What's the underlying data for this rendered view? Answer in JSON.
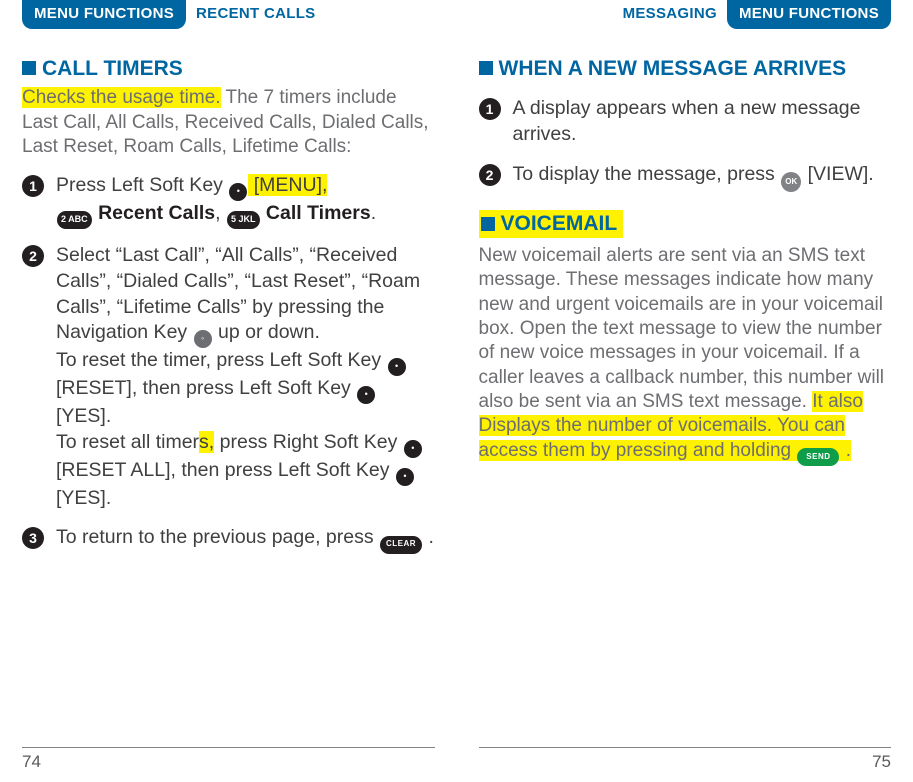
{
  "left": {
    "menuTab": "MENU FUNCTIONS",
    "sectionLabel": "RECENT CALLS",
    "heading": "CALL TIMERS",
    "intro_hl": "Checks the usage time.",
    "intro_rest": " The 7 timers include Last Call, All Calls, Received Calls, Dialed Calls, Last Reset, Roam Calls, Lifetime Calls:",
    "step1_a": "Press Left Soft Key ",
    "step1_b_hl": " [MENU], ",
    "step1_c_bold": " Recent Calls",
    "step1_d": ", ",
    "step1_e_bold": " Call Timers",
    "step1_f": ".",
    "step2_a": "Select “Last Call”, “All Calls”, “Received Calls”, “Dialed Calls”, “Last Reset”, “Roam Calls”, “Lifetime Calls” by pressing the Navigation Key ",
    "step2_b": " up or down.",
    "step2_c": "To reset the timer, press Left Soft Key ",
    "step2_d": " [RESET], then press Left Soft Key ",
    "step2_e": " [YES].",
    "step2_f": "To reset all timer",
    "step2_g_hl": "s,",
    "step2_h": " press Right Soft Key ",
    "step2_i": " [RESET ALL], then press Left Soft Key ",
    "step2_j": " [YES].",
    "step3_a": "To return to the previous page, press ",
    "step3_b": " .",
    "key2": "2 ABC",
    "key5": "5 JKL",
    "keyClear": "CLEAR",
    "pageNum": "74"
  },
  "right": {
    "menuTab": "MENU FUNCTIONS",
    "sectionLabel": "MESSAGING",
    "heading": "WHEN A NEW MESSAGE ARRIVES",
    "step1": "A display appears when a new message arrives.",
    "step2_a": "To display the message, press ",
    "step2_b": " [VIEW].",
    "keyOk": "OK",
    "vmHeading": "VOICEMAIL",
    "vm_a": "New voicemail alerts are sent via an SMS text message. These messages indicate how many new and urgent voicemails are in your voicemail box. Open the text message to view the number of new voice messages in your voicemail. If a caller leaves a callback number, this number will also be sent via an SMS text message. ",
    "vm_b_hl1": "It also Displays the number of voicemails. You can access them by pressing and holding ",
    "vm_b_hl2": " .",
    "keySend": "SEND",
    "pageNum": "75"
  }
}
